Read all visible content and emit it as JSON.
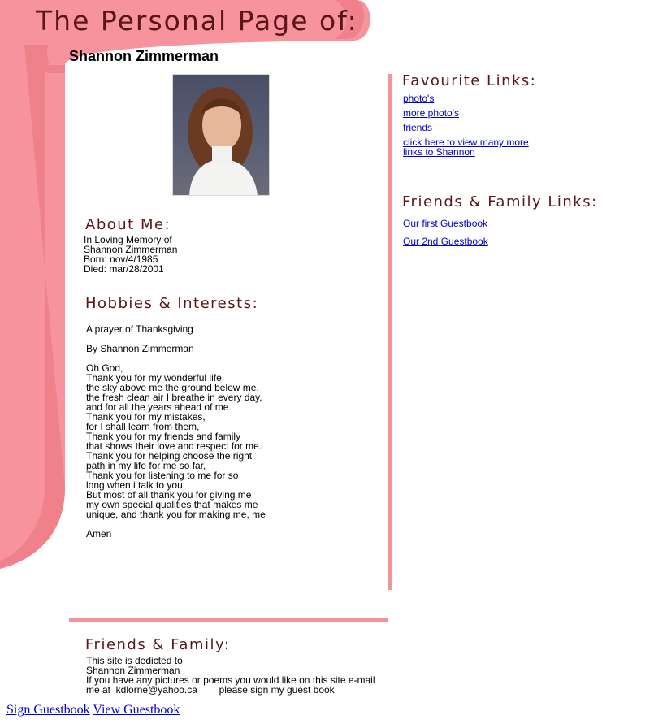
{
  "header": {
    "title": "The Personal Page of:",
    "name": "Shannon Zimmerman"
  },
  "colors": {
    "pink": "#f7939c",
    "dark_pink": "#ee8189",
    "heading": "#5a1518",
    "link": "#0000cc"
  },
  "about": {
    "heading": "About Me:",
    "text": "In Loving Memory of\nShannon Zimmerman\nBorn: nov/4/1985\nDied: mar/28/2001"
  },
  "hobbies": {
    "heading": "Hobbies & Interests:",
    "poem_title": "A prayer of Thanksgiving",
    "poem_author": "By Shannon Zimmerman",
    "poem_body": "Oh God,\nThank you for my wonderful life,\nthe sky above me the ground below me,\nthe fresh clean air I breathe in every day,\nand for all the years ahead of me.\nThank you for my mistakes,\nfor I shall learn from them,\nThank you for my friends and family\nthat shows their love and respect for me.\nThank you for helping choose the right\npath in my life for me so far,\nThank you for listening to me for so\nlong when i talk to you.\nBut most of all thank you for giving me\nmy own special qualities that makes me\nunique, and thank you for making me, me",
    "poem_end": "Amen"
  },
  "favourite_links": {
    "heading": "Favourite Links:",
    "items": [
      "photo's",
      "more photo's",
      "friends",
      "click here to view many more\nlinks to Shannon"
    ]
  },
  "friends_family_links": {
    "heading": "Friends & Family Links:",
    "items": [
      "Our first Guestbook",
      "Our 2nd Guestbook"
    ]
  },
  "friends_family": {
    "heading": "Friends & Family:",
    "text": "This site is dedicted to\nShannon Zimmerman\nIf you have any pictures or poems you would like on this site e-mail\nme at  kdlorne@yahoo.ca        please sign my guest book"
  },
  "footer": {
    "sign_label": "Sign Guestbook",
    "view_label": "View Guestbook"
  }
}
